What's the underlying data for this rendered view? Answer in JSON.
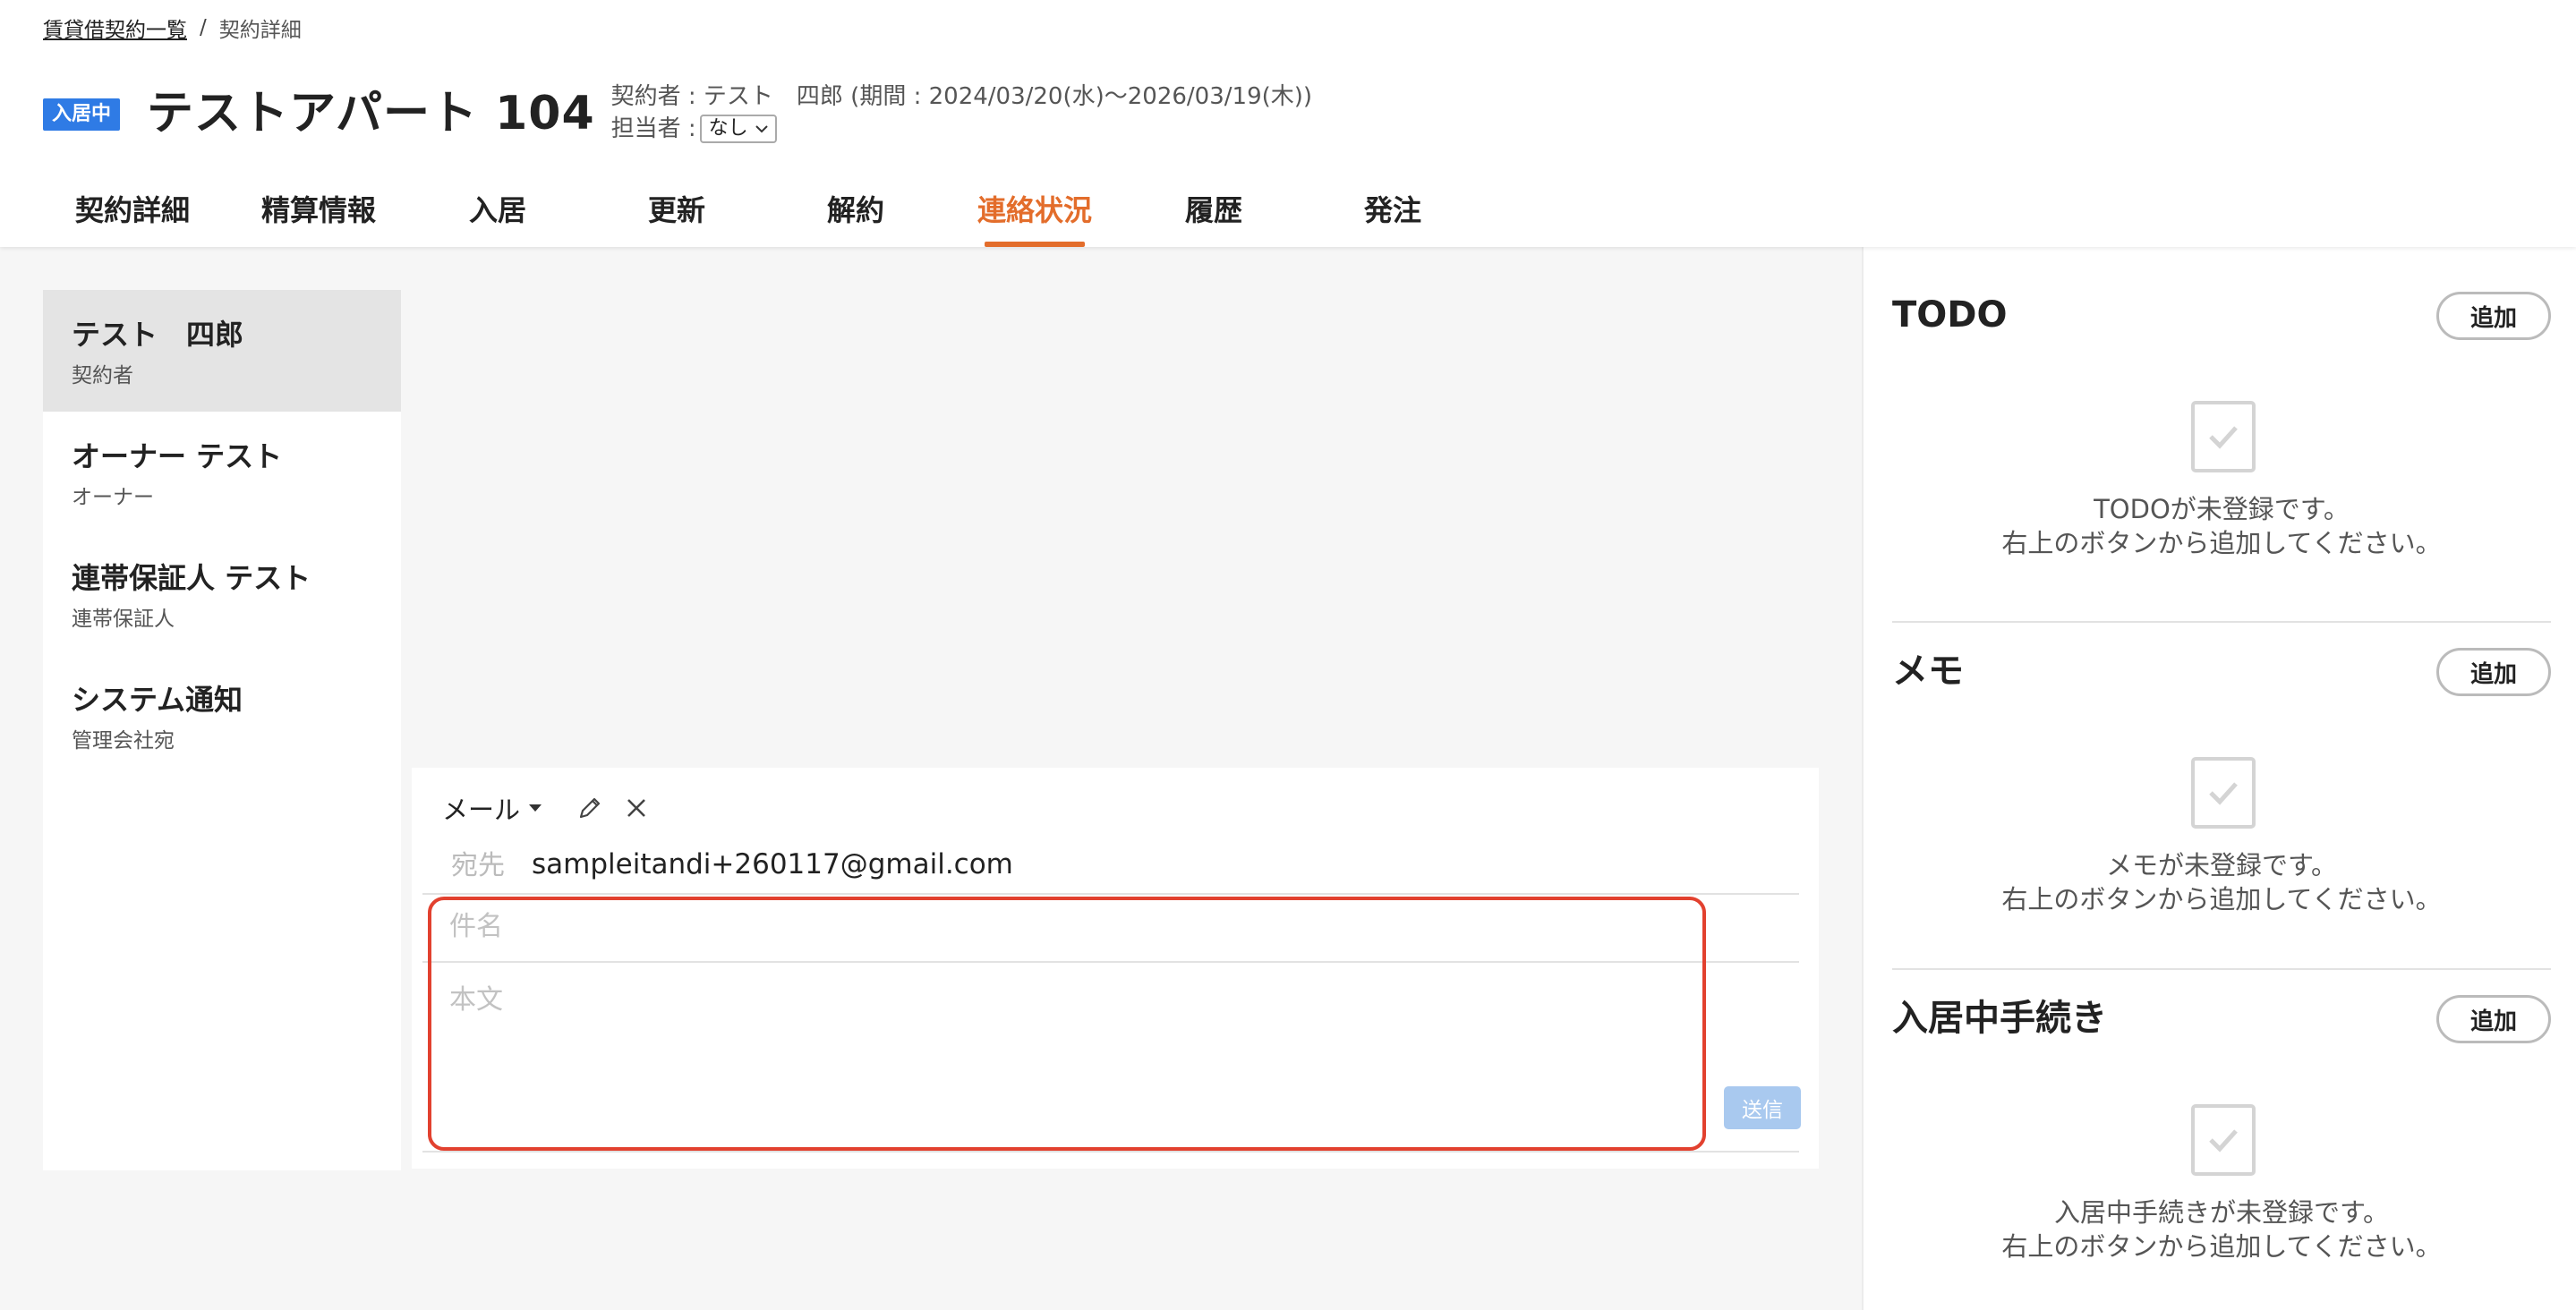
{
  "breadcrumb": {
    "parent": "賃貸借契約一覧",
    "separator": "/",
    "current": "契約詳細"
  },
  "header": {
    "status_badge": "入居中",
    "title": "テストアパート 104",
    "contract_info": "契約者 : テスト　四郎 (期間 : 2024/03/20(水)〜2026/03/19(木))",
    "assignee_label": "担当者 :",
    "assignee_value": "なし"
  },
  "tabs": [
    {
      "label": "契約詳細",
      "active": false
    },
    {
      "label": "精算情報",
      "active": false
    },
    {
      "label": "入居",
      "active": false
    },
    {
      "label": "更新",
      "active": false
    },
    {
      "label": "解約",
      "active": false
    },
    {
      "label": "連絡状況",
      "active": true
    },
    {
      "label": "履歴",
      "active": false
    },
    {
      "label": "発注",
      "active": false
    }
  ],
  "contacts": [
    {
      "name": "テスト　四郎",
      "role": "契約者",
      "selected": true
    },
    {
      "name": "オーナー テスト",
      "role": "オーナー",
      "selected": false
    },
    {
      "name": "連帯保証人 テスト",
      "role": "連帯保証人",
      "selected": false
    },
    {
      "name": "システム通知",
      "role": "管理会社宛",
      "selected": false
    }
  ],
  "composer": {
    "mode": "メール",
    "to_label": "宛先",
    "to_value": "sampleitandi+260117@gmail.com",
    "subject_placeholder": "件名",
    "subject_value": "",
    "body_placeholder": "本文",
    "body_value": "",
    "send_label": "送信",
    "icons": {
      "edit": "pencil-icon",
      "close": "close-icon",
      "mode_caret": "caret-down-icon"
    }
  },
  "sidebar": {
    "todo": {
      "title": "TODO",
      "add_label": "追加",
      "empty_line1": "TODOが未登録です。",
      "empty_line2": "右上のボタンから追加してください。"
    },
    "memo": {
      "title": "メモ",
      "add_label": "追加",
      "empty_line1": "メモが未登録です。",
      "empty_line2": "右上のボタンから追加してください。"
    },
    "procedures": {
      "title": "入居中手続き",
      "add_label": "追加",
      "empty_line1": "入居中手続きが未登録です。",
      "empty_line2": "右上のボタンから追加してください。"
    }
  },
  "colors": {
    "accent": "#e36d2b",
    "badge": "#2f7be5",
    "highlight": "#e2412f",
    "send_disabled": "#a9c9ef"
  }
}
